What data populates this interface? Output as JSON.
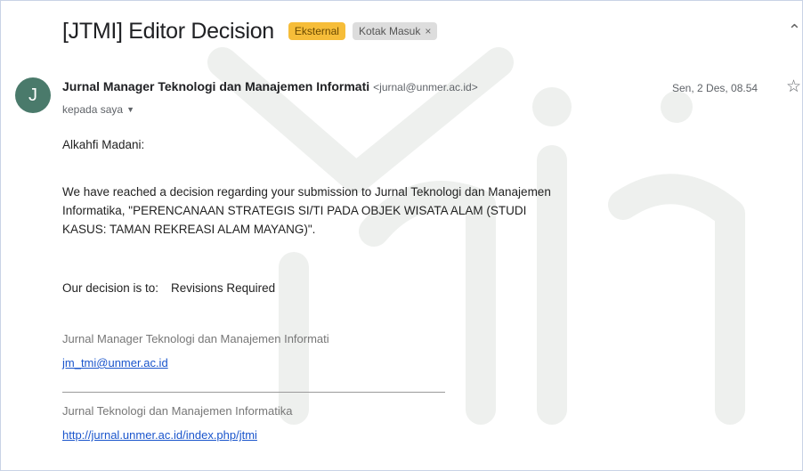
{
  "email": {
    "subject": "[JTMI] Editor Decision",
    "labels": {
      "external": "Eksternal",
      "inbox": "Kotak Masuk",
      "inbox_remove": "×"
    },
    "avatar_letter": "J",
    "sender_name": "Jurnal Manager Teknologi dan Manajemen Informati",
    "sender_email": "<jurnal@unmer.ac.id>",
    "recipient": "kepada saya",
    "date": "Sen, 2 Des, 08.54",
    "greeting": "Alkahfi Madani:",
    "paragraph": "We have reached a decision regarding your submission to Jurnal Teknologi dan Manajemen Informatika, \"PERENCANAAN STRATEGIS SI/TI PADA OBJEK WISATA ALAM (STUDI KASUS: TAMAN REKREASI ALAM MAYANG)\".",
    "decision_label": "Our decision is to:",
    "decision_value": "Revisions Required",
    "signature_name": "Jurnal Manager Teknologi dan Manajemen Informati",
    "signature_email": "jm_tmi@unmer.ac.id",
    "journal_name": "Jurnal Teknologi dan Manajemen Informatika",
    "journal_url": "http://jurnal.unmer.ac.id/index.php/jtmi"
  },
  "icons": {
    "star": "star-icon",
    "caret": "caret-down-icon",
    "expand": "unfold-icon"
  },
  "colors": {
    "external_badge": "#f6bd39",
    "avatar": "#4a7a6b",
    "link": "#1a55cc"
  }
}
